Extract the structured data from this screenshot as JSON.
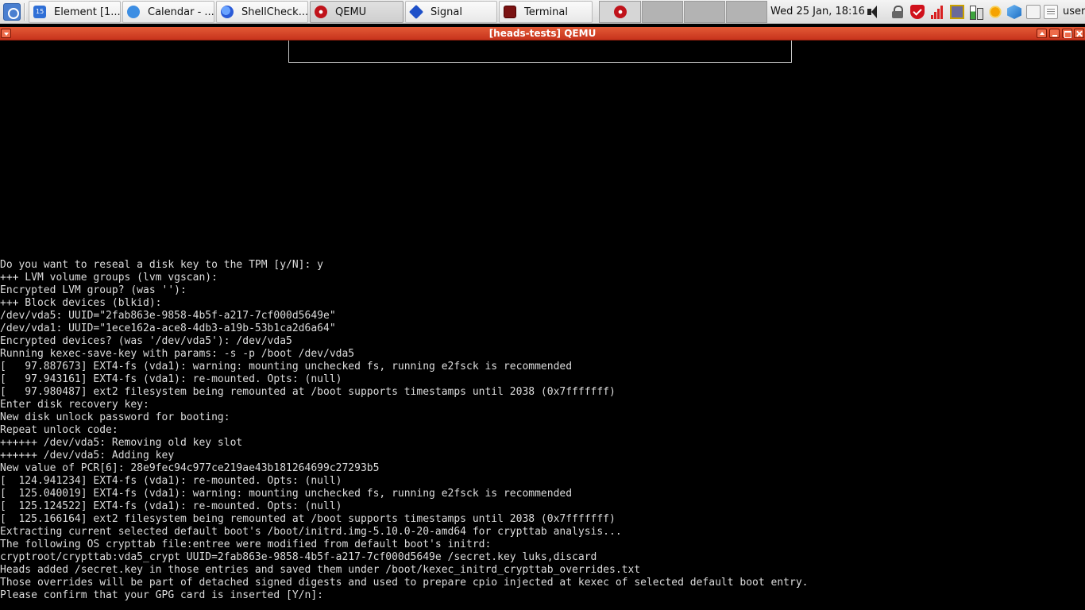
{
  "taskbar": {
    "tasks": [
      {
        "label": "Element [1...",
        "icon": "element-icon"
      },
      {
        "label": "Calendar - ...",
        "icon": "calendar-icon"
      },
      {
        "label": "ShellCheck...",
        "icon": "firefox-icon"
      },
      {
        "label": "QEMU",
        "icon": "qemu-icon"
      },
      {
        "label": "Signal",
        "icon": "signal-icon"
      },
      {
        "label": "Terminal",
        "icon": "terminal-icon"
      }
    ],
    "clock": "Wed 25 Jan, 18:16",
    "user": "user",
    "calendar_badge": "15"
  },
  "window": {
    "title": "[heads-tests] QEMU"
  },
  "console": {
    "lines": [
      "Do you want to reseal a disk key to the TPM [y/N]: y",
      "+++ LVM volume groups (lvm vgscan):",
      "Encrypted LVM group? (was ''):",
      "+++ Block devices (blkid):",
      "/dev/vda5: UUID=\"2fab863e-9858-4b5f-a217-7cf000d5649e\"",
      "/dev/vda1: UUID=\"1ece162a-ace8-4db3-a19b-53b1ca2d6a64\"",
      "Encrypted devices? (was '/dev/vda5'): /dev/vda5",
      "Running kexec-save-key with params: -s -p /boot /dev/vda5",
      "[   97.887673] EXT4-fs (vda1): warning: mounting unchecked fs, running e2fsck is recommended",
      "[   97.943161] EXT4-fs (vda1): re-mounted. Opts: (null)",
      "[   97.980487] ext2 filesystem being remounted at /boot supports timestamps until 2038 (0x7fffffff)",
      "Enter disk recovery key:",
      "New disk unlock password for booting:",
      "Repeat unlock code:",
      "++++++ /dev/vda5: Removing old key slot",
      "++++++ /dev/vda5: Adding key",
      "New value of PCR[6]: 28e9fec94c977ce219ae43b181264699c27293b5",
      "[  124.941234] EXT4-fs (vda1): re-mounted. Opts: (null)",
      "[  125.040019] EXT4-fs (vda1): warning: mounting unchecked fs, running e2fsck is recommended",
      "[  125.124522] EXT4-fs (vda1): re-mounted. Opts: (null)",
      "[  125.166164] ext2 filesystem being remounted at /boot supports timestamps until 2038 (0x7fffffff)",
      "Extracting current selected default boot's /boot/initrd.img-5.10.0-20-amd64 for crypttab analysis...",
      "The following OS crypttab file:entree were modified from default boot's initrd:",
      "cryptroot/crypttab:vda5_crypt UUID=2fab863e-9858-4b5f-a217-7cf000d5649e /secret.key luks,discard",
      "Heads added /secret.key in those entries and saved them under /boot/kexec_initrd_crypttab_overrides.txt",
      "Those overrides will be part of detached signed digests and used to prepare cpio injected at kexec of selected default boot entry.",
      "Please confirm that your GPG card is inserted [Y/n]:"
    ]
  }
}
